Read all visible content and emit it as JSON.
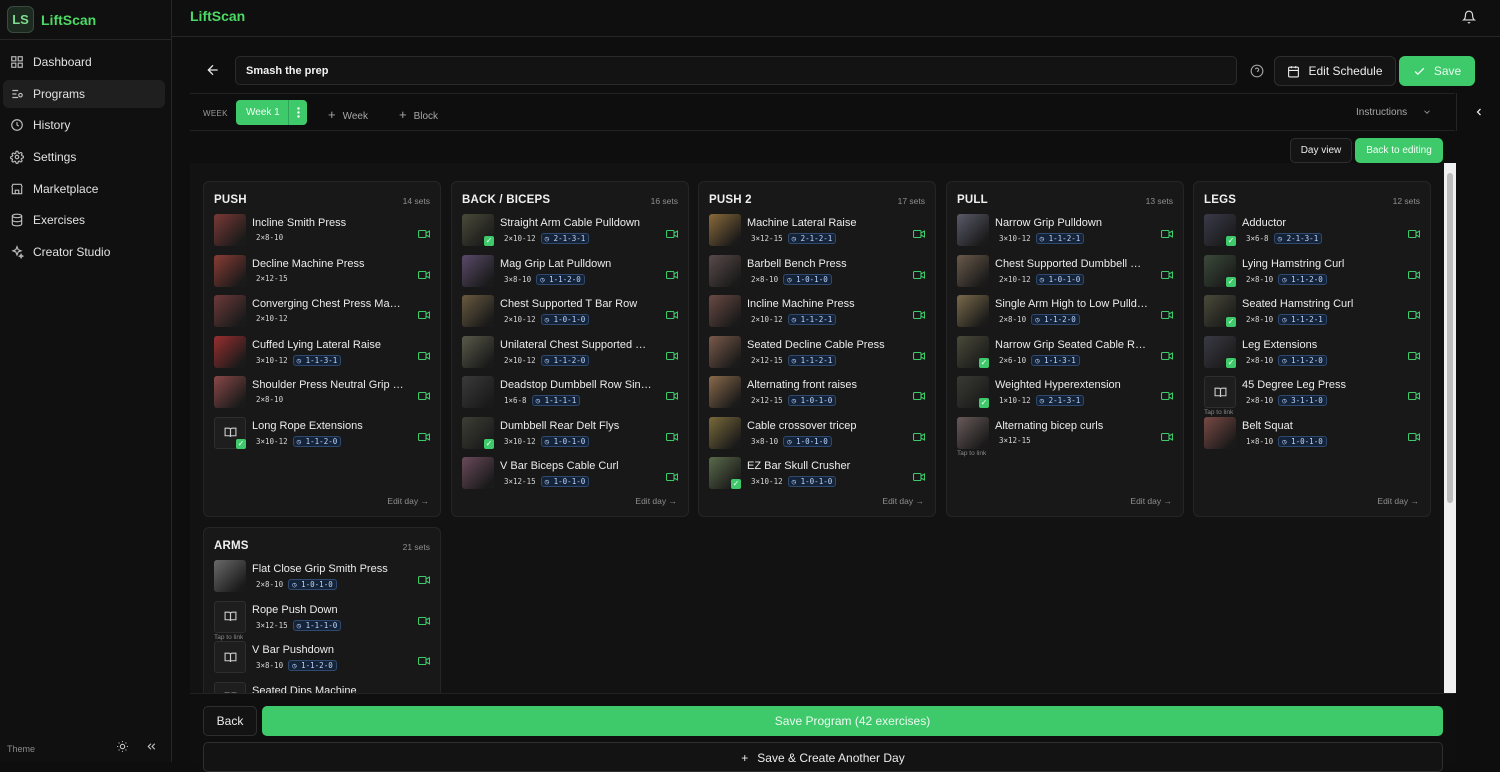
{
  "brand": {
    "name": "LiftScan",
    "logo_text": "LS"
  },
  "sidebar": {
    "items": [
      {
        "label": "Dashboard",
        "icon": "grid-icon"
      },
      {
        "label": "Programs",
        "icon": "programs-icon"
      },
      {
        "label": "History",
        "icon": "history-icon"
      },
      {
        "label": "Settings",
        "icon": "gear-icon"
      },
      {
        "label": "Marketplace",
        "icon": "store-icon"
      },
      {
        "label": "Exercises",
        "icon": "database-icon"
      },
      {
        "label": "Creator Studio",
        "icon": "sparkle-icon"
      }
    ],
    "active_index": 1,
    "theme_label": "Theme"
  },
  "header": {
    "title": "LiftScan"
  },
  "program": {
    "name": "Smash the prep",
    "edit_schedule_label": "Edit Schedule",
    "save_label": "Save"
  },
  "week_bar": {
    "label": "WEEK",
    "active_week": "Week 1",
    "add_week_label": "Week",
    "add_block_label": "Block",
    "instructions_label": "Instructions"
  },
  "view_buttons": {
    "day_view": "Day view",
    "back_to_editing": "Back to editing"
  },
  "days": [
    {
      "title": "PUSH",
      "sets": "14 sets",
      "edit": "Edit day",
      "exercises": [
        {
          "name": "Incline Smith Press",
          "scheme": "2×8-10",
          "tempo": "",
          "thumb": "#7a3a36",
          "linked": false,
          "check": false
        },
        {
          "name": "Decline Machine Press",
          "scheme": "2×12-15",
          "tempo": "",
          "thumb": "#8a3c34",
          "linked": false,
          "check": false
        },
        {
          "name": "Converging Chest Press Machine",
          "scheme": "2×10-12",
          "tempo": "",
          "thumb": "#6d3a3a",
          "linked": false,
          "check": false
        },
        {
          "name": "Cuffed Lying Lateral Raise",
          "scheme": "3×10-12",
          "tempo": "1-1-3-1",
          "thumb": "#9a2f2f",
          "linked": false,
          "check": false
        },
        {
          "name": "Shoulder Press Neutral Grip Machine",
          "scheme": "2×8-10",
          "tempo": "",
          "thumb": "#8a4848",
          "linked": false,
          "check": false
        },
        {
          "name": "Long Rope Extensions",
          "scheme": "3×10-12",
          "tempo": "1-1-2-0",
          "thumb": "",
          "linked": false,
          "check": true,
          "book": true
        }
      ]
    },
    {
      "title": "BACK / BICEPS",
      "sets": "16 sets",
      "edit": "Edit day",
      "exercises": [
        {
          "name": "Straight Arm Cable Pulldown",
          "scheme": "2×10-12",
          "tempo": "2-1-3-1",
          "thumb": "#4a4a3a",
          "linked": false,
          "check": true
        },
        {
          "name": "Mag Grip Lat Pulldown",
          "scheme": "3×8-10",
          "tempo": "1-1-2-0",
          "thumb": "#5a4a6a",
          "linked": false,
          "check": false
        },
        {
          "name": "Chest Supported T Bar Row",
          "scheme": "2×10-12",
          "tempo": "1-0-1-0",
          "thumb": "#6a5a40",
          "linked": false,
          "check": false
        },
        {
          "name": "Unilateral Chest Supported Upper Back Row",
          "scheme": "2×10-12",
          "tempo": "1-1-2-0",
          "thumb": "#5a5a4a",
          "linked": false,
          "check": false
        },
        {
          "name": "Deadstop Dumbbell Row Single Arm",
          "scheme": "1×6-8",
          "tempo": "1-1-1-1",
          "thumb": "#3a3a3a",
          "linked": false,
          "check": false
        },
        {
          "name": "Dumbbell Rear Delt Flys",
          "scheme": "3×10-12",
          "tempo": "1-0-1-0",
          "thumb": "#3e3e36",
          "linked": false,
          "check": true
        },
        {
          "name": "V Bar Biceps Cable Curl",
          "scheme": "3×12-15",
          "tempo": "1-0-1-0",
          "thumb": "#6a4a5a",
          "linked": false,
          "check": false
        }
      ]
    },
    {
      "title": "PUSH 2",
      "sets": "17 sets",
      "edit": "Edit day",
      "exercises": [
        {
          "name": "Machine Lateral Raise",
          "scheme": "3×12-15",
          "tempo": "2-1-2-1",
          "thumb": "#8a6a3a",
          "linked": false,
          "check": false
        },
        {
          "name": "Barbell Bench Press",
          "scheme": "2×8-10",
          "tempo": "1-0-1-0",
          "thumb": "#5a4a4a",
          "linked": false,
          "check": false
        },
        {
          "name": "Incline Machine Press",
          "scheme": "2×10-12",
          "tempo": "1-1-2-1",
          "thumb": "#6a4a44",
          "linked": false,
          "check": false
        },
        {
          "name": "Seated Decline Cable Press",
          "scheme": "2×12-15",
          "tempo": "1-1-2-1",
          "thumb": "#7a5a4a",
          "linked": false,
          "check": false
        },
        {
          "name": "Alternating front raises",
          "scheme": "2×12-15",
          "tempo": "1-0-1-0",
          "thumb": "#8a6a4a",
          "linked": false,
          "check": false
        },
        {
          "name": "Cable crossover tricep",
          "scheme": "3×8-10",
          "tempo": "1-0-1-0",
          "thumb": "#7a6a3a",
          "linked": false,
          "check": false
        },
        {
          "name": "EZ Bar Skull Crusher",
          "scheme": "3×10-12",
          "tempo": "1-0-1-0",
          "thumb": "#5a6a4a",
          "linked": false,
          "check": true
        }
      ]
    },
    {
      "title": "PULL",
      "sets": "13 sets",
      "edit": "Edit day",
      "exercises": [
        {
          "name": "Narrow Grip Pulldown",
          "scheme": "3×10-12",
          "tempo": "1-1-2-1",
          "thumb": "#5a5a6a",
          "linked": false,
          "check": false
        },
        {
          "name": "Chest Supported Dumbbell Row",
          "scheme": "2×10-12",
          "tempo": "1-0-1-0",
          "thumb": "#6a5a4a",
          "linked": false,
          "check": false
        },
        {
          "name": "Single Arm High to Low Pulldown",
          "scheme": "2×8-10",
          "tempo": "1-1-2-0",
          "thumb": "#7a6a4a",
          "linked": false,
          "check": false
        },
        {
          "name": "Narrow Grip Seated Cable Row",
          "scheme": "2×6-10",
          "tempo": "1-1-3-1",
          "thumb": "#4a4a3a",
          "linked": false,
          "check": true
        },
        {
          "name": "Weighted Hyperextension",
          "scheme": "1×10-12",
          "tempo": "2-1-3-1",
          "thumb": "#3a3a34",
          "linked": false,
          "check": true
        },
        {
          "name": "Alternating bicep curls",
          "scheme": "3×12-15",
          "tempo": "",
          "thumb": "#6a5a5a",
          "linked": true,
          "check": false
        }
      ]
    },
    {
      "title": "LEGS",
      "sets": "12 sets",
      "edit": "Edit day",
      "exercises": [
        {
          "name": "Adductor",
          "scheme": "3×6-8",
          "tempo": "2-1-3-1",
          "thumb": "#3a3a4a",
          "linked": false,
          "check": true
        },
        {
          "name": "Lying Hamstring Curl",
          "scheme": "2×8-10",
          "tempo": "1-1-2-0",
          "thumb": "#3a4a3a",
          "linked": false,
          "check": true
        },
        {
          "name": "Seated Hamstring Curl",
          "scheme": "2×8-10",
          "tempo": "1-1-2-1",
          "thumb": "#4a4a3a",
          "linked": false,
          "check": true
        },
        {
          "name": "Leg Extensions",
          "scheme": "2×8-10",
          "tempo": "1-1-2-0",
          "thumb": "#3a3a44",
          "linked": false,
          "check": true
        },
        {
          "name": "45 Degree Leg Press",
          "scheme": "2×8-10",
          "tempo": "3-1-1-0",
          "thumb": "",
          "linked": true,
          "check": false,
          "book": true
        },
        {
          "name": "Belt Squat",
          "scheme": "1×8-10",
          "tempo": "1-0-1-0",
          "thumb": "#7a4a44",
          "linked": false,
          "check": false
        }
      ]
    },
    {
      "title": "ARMS",
      "sets": "21 sets",
      "edit": "",
      "exercises": [
        {
          "name": "Flat Close Grip Smith Press",
          "scheme": "2×8-10",
          "tempo": "1-0-1-0",
          "thumb": "#6a6a6a",
          "linked": false,
          "check": false
        },
        {
          "name": "Rope Push Down",
          "scheme": "3×12-15",
          "tempo": "1-1-1-0",
          "thumb": "",
          "linked": true,
          "check": false,
          "book": true
        },
        {
          "name": "V Bar Pushdown",
          "scheme": "3×8-10",
          "tempo": "1-1-2-0",
          "thumb": "",
          "linked": false,
          "check": false,
          "book": true
        },
        {
          "name": "Seated Dips Machine",
          "scheme": "",
          "tempo": "",
          "thumb": "",
          "linked": false,
          "check": false,
          "book": true
        }
      ]
    }
  ],
  "tap_to_link": "Tap to link",
  "footer": {
    "back_label": "Back",
    "save_program_label": "Save Program (42 exercises)",
    "save_create_label": "Save & Create Another Day"
  }
}
